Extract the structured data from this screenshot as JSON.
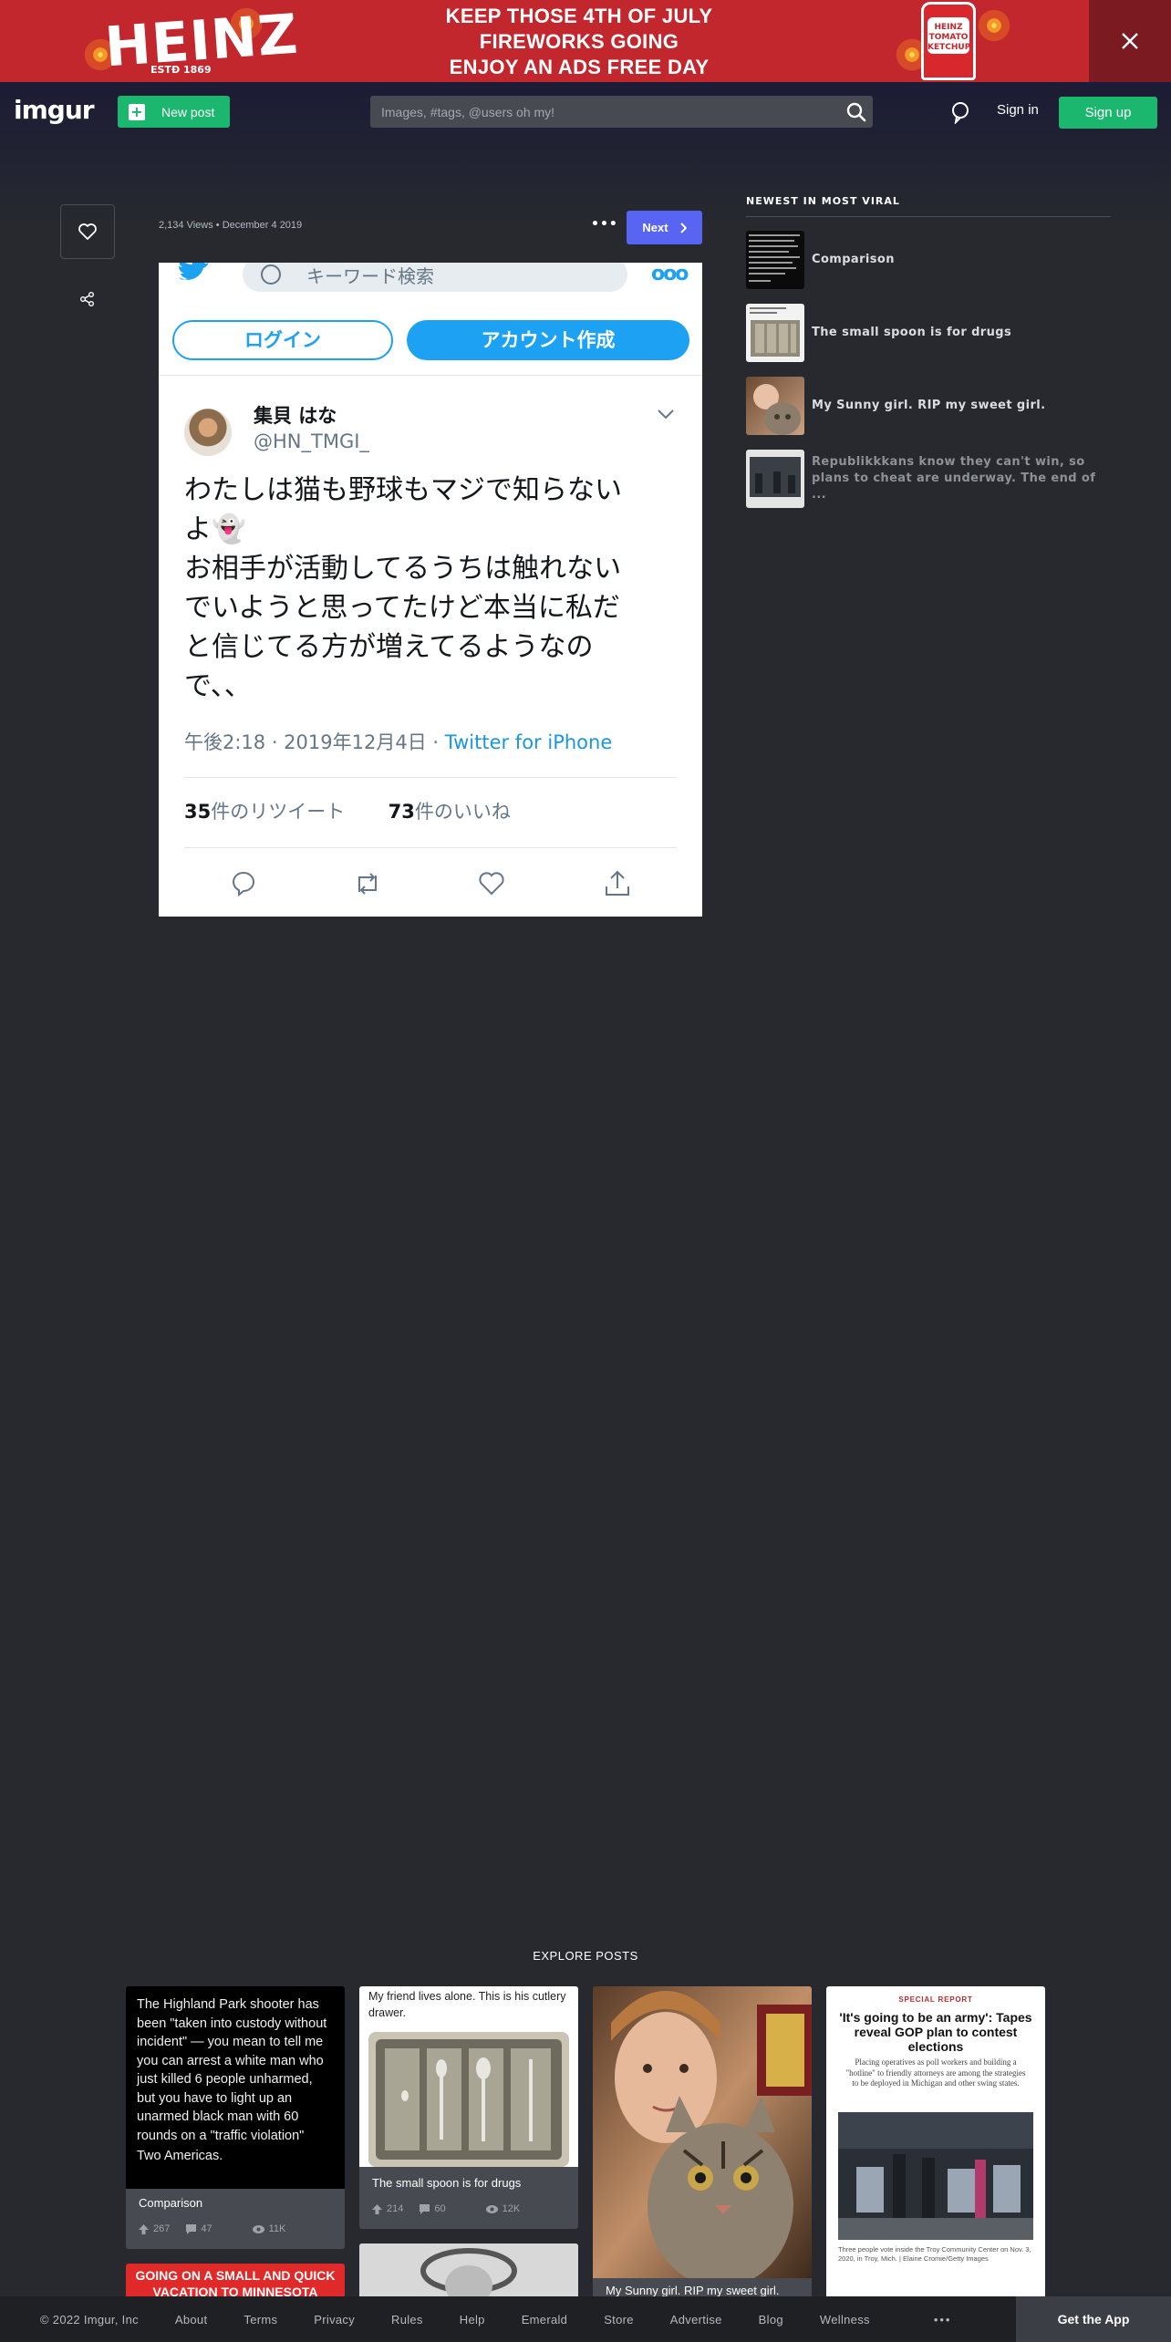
{
  "ad": {
    "brand": "HEINZ",
    "established": "ESTÐ 1869",
    "lines": [
      "KEEP THOSE 4TH OF JULY",
      "FIREWORKS GOING",
      "ENJOY AN ADS FREE DAY"
    ],
    "bottle_label": [
      "HEINZ",
      "TOMATO",
      "KETCHUP"
    ]
  },
  "header": {
    "logo": "imgur",
    "new_post": "New post",
    "search_placeholder": "Images, #tags, @users oh my!",
    "sign_in": "Sign in",
    "sign_up": "Sign up"
  },
  "post": {
    "views": "2,134 Views",
    "date": "December 4 2019",
    "next_label": "Next"
  },
  "tweet": {
    "search_placeholder": "キーワード検索",
    "login": "ログイン",
    "signup": "アカウント作成",
    "name": "集貝 はな",
    "handle": "@HN_TMGI_",
    "lines": [
      "わたしは猫も野球もマジで知らない",
      "よ👻",
      "お相手が活動してるうちは触れない",
      "でいようと思ってたけど本当に私だ",
      "と信じてる方が増えてるようなの",
      "で、、"
    ],
    "time": "午後2:18 · 2019年12月4日 · ",
    "via": "Twitter for iPhone",
    "retweet_count": "35",
    "retweet_label": "件のリツイート",
    "like_count": "73",
    "like_label": "件のいいね"
  },
  "sidebar": {
    "title": "NEWEST IN MOST VIRAL",
    "items": [
      {
        "title": "Comparison"
      },
      {
        "title": "The small spoon is for drugs"
      },
      {
        "title": "My Sunny girl. RIP my sweet girl."
      },
      {
        "title": "Republikkkans know they can't win, so plans to cheat are underway. The end of ..."
      }
    ]
  },
  "explore": {
    "title": "EXPLORE POSTS",
    "cards": [
      {
        "text": "The Highland Park shooter has been \"taken into custody without incident\" — you mean to tell me you can arrest a white man who just killed 6 people unharmed, but you have to light up an unarmed black man with 60 rounds on a \"traffic violation\"",
        "subtext": "Two Americas.",
        "title": "Comparison",
        "upvotes": "267",
        "comments": "47",
        "views": "11K"
      },
      {
        "text": "My friend lives alone. This is his cutlery drawer.",
        "title": "The small spoon is for drugs",
        "upvotes": "214",
        "comments": "60",
        "views": "12K"
      },
      {
        "title": "My Sunny girl. RIP my sweet girl."
      },
      {
        "kicker": "SPECIAL REPORT",
        "headline": "'It's going to be an army': Tapes reveal GOP plan to contest elections",
        "dek": "Placing operatives as poll workers and building a \"hotline\" to friendly attorneys are among the strategies to be deployed in Michigan and other swing states.",
        "caption": "Three people vote inside the Troy Community Center on Nov. 3, 2020, in Troy, Mich. | Elaine Cromie/Getty Images"
      }
    ],
    "partial_banner": "GOING ON A SMALL AND QUICK VACATION TO MINNESOTA"
  },
  "footer": {
    "items": [
      "© 2022 Imgur, Inc",
      "About",
      "Terms",
      "Privacy",
      "Rules",
      "Help",
      "Emerald",
      "Store",
      "Advertise",
      "Blog",
      "Wellness"
    ],
    "more": "•••",
    "get_app": "Get the App"
  },
  "colors": {
    "background": "#27292f",
    "accent_green": "#1bb76e",
    "next_blue": "#5865f2",
    "ad_red": "#c1272d",
    "twitter_blue": "#1da1f2"
  }
}
